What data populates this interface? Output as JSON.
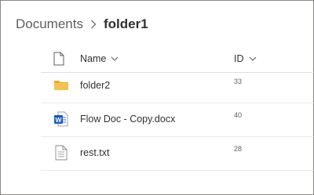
{
  "breadcrumb": {
    "root": "Documents",
    "current": "folder1"
  },
  "columns": {
    "name": "Name",
    "id": "ID"
  },
  "rows": [
    {
      "name": "folder2",
      "id": "33",
      "icon": "folder-icon"
    },
    {
      "name": "Flow Doc - Copy.docx",
      "id": "40",
      "icon": "word-document-icon"
    },
    {
      "name": "rest.txt",
      "id": "28",
      "icon": "text-file-icon"
    }
  ],
  "colors": {
    "folder": "#f4c44a",
    "word_blue": "#185abd",
    "text": "#323130",
    "muted": "#605e5c"
  }
}
